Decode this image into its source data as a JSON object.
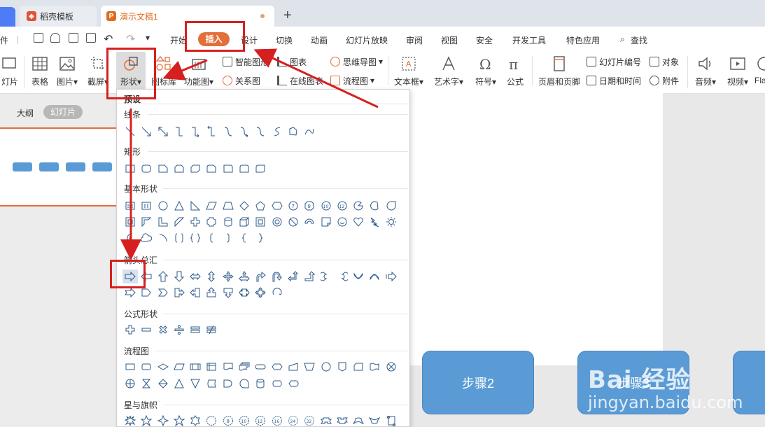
{
  "tabs": {
    "template": "稻壳模板",
    "document": "演示文稿1",
    "new_tab": "+"
  },
  "menubar": {
    "file": "件",
    "items": [
      "开始",
      "插入",
      "设计",
      "切换",
      "动画",
      "幻灯片放映",
      "审阅",
      "视图",
      "安全",
      "开发工具",
      "特色应用"
    ],
    "search": "查找",
    "active": "插入"
  },
  "ribbon": {
    "new_slide": "灯片",
    "table": "表格",
    "picture": "图片",
    "screenshot": "截屏",
    "shape": "形状",
    "icon_lib": "图标库",
    "function_chart": "功能图",
    "smart_graphic": "智能图形",
    "relation_chart": "关系图",
    "chart": "图表",
    "online_chart": "在线图表",
    "mind_map": "思维导图",
    "flowchart": "流程图",
    "textbox": "文本框",
    "word_art": "艺术字",
    "symbol": "符号",
    "formula": "公式",
    "header_footer": "页眉和页脚",
    "slide_number": "幻灯片编号",
    "date_time": "日期和时间",
    "object": "对象",
    "attachment": "附件",
    "audio": "音频",
    "video": "视频",
    "flash": "Fla"
  },
  "left_panel": {
    "outline": "大纲",
    "slides": "幻灯片"
  },
  "shape_menu": {
    "preset": "预设",
    "lines": "线条",
    "rectangles": "矩形",
    "basic_shapes": "基本形状",
    "block_arrows": "箭头总汇",
    "equation_shapes": "公式形状",
    "flowchart": "流程图",
    "stars_banners": "星与旗帜"
  },
  "canvas": {
    "step2": "步骤2",
    "step3": "步骤3"
  },
  "watermark": {
    "brand": "Bai 经验",
    "url": "jingyan.baidu.com"
  },
  "colors": {
    "accent": "#e36f3b",
    "highlight": "#d62020",
    "step_fill": "#5b9bd5",
    "shape_stroke": "#2f5b8a"
  }
}
